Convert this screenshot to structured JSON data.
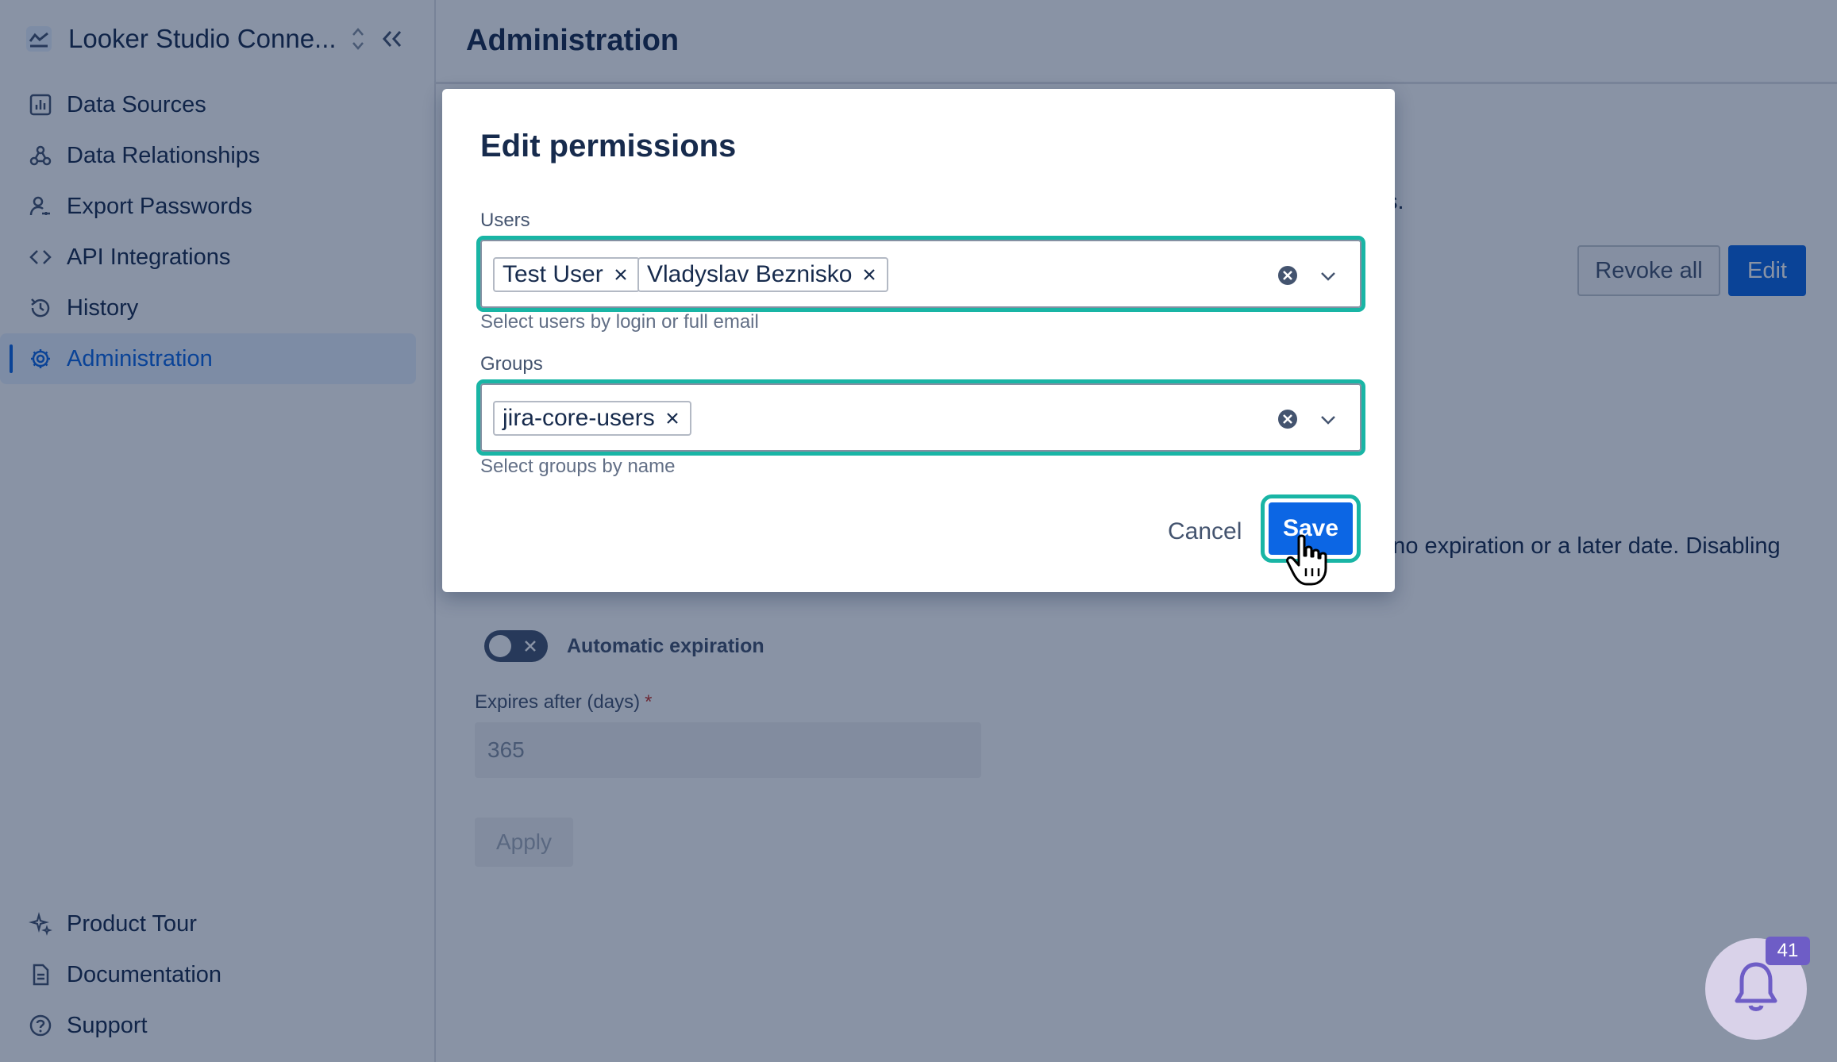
{
  "sidebar": {
    "app_title": "Looker Studio Conne...",
    "items": [
      {
        "label": "Data Sources",
        "icon": "chart-icon"
      },
      {
        "label": "Data Relationships",
        "icon": "relationships-icon"
      },
      {
        "label": "Export Passwords",
        "icon": "user-key-icon"
      },
      {
        "label": "API Integrations",
        "icon": "code-icon"
      },
      {
        "label": "History",
        "icon": "history-icon"
      },
      {
        "label": "Administration",
        "icon": "gear-icon",
        "active": true
      }
    ],
    "bottom_items": [
      {
        "label": "Product Tour",
        "icon": "sparkle-icon"
      },
      {
        "label": "Documentation",
        "icon": "document-icon"
      },
      {
        "label": "Support",
        "icon": "help-icon"
      }
    ]
  },
  "main": {
    "title": "Administration",
    "bg_text_fragment": "s.",
    "revoke_all_label": "Revoke all",
    "edit_label": "Edit",
    "description_fragment": "e no expiration or a later date. Disabling",
    "automatic_expiration_label": "Automatic expiration",
    "expires_label": "Expires after (days)",
    "expires_required": "*",
    "expires_value": "365",
    "apply_label": "Apply"
  },
  "modal": {
    "title": "Edit permissions",
    "users_label": "Users",
    "users": [
      "Test User",
      "Vladyslav Beznisko"
    ],
    "users_helper": "Select users by login or full email",
    "groups_label": "Groups",
    "groups": [
      "jira-core-users"
    ],
    "groups_helper": "Select groups by name",
    "cancel_label": "Cancel",
    "save_label": "Save"
  },
  "notifications": {
    "count": "41"
  },
  "colors": {
    "accent": "#0c66e4",
    "highlight": "#19b5a5",
    "overlay": "rgba(9, 30, 66, 0.48)"
  }
}
